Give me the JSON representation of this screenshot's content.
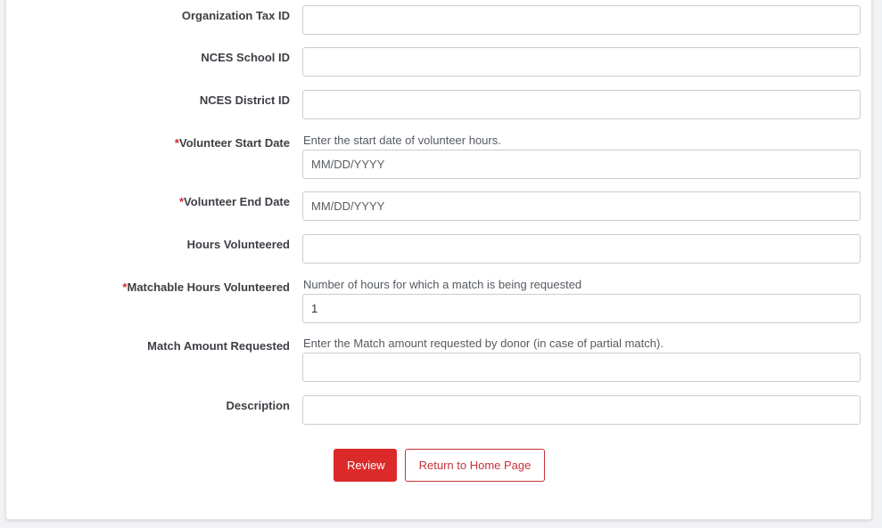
{
  "form": {
    "fields": [
      {
        "label": "Organization Tax ID",
        "required": false,
        "help": "",
        "value": "",
        "placeholder": ""
      },
      {
        "label": "NCES School ID",
        "required": false,
        "help": "",
        "value": "",
        "placeholder": ""
      },
      {
        "label": "NCES District ID",
        "required": false,
        "help": "",
        "value": "",
        "placeholder": ""
      },
      {
        "label": "Volunteer Start Date",
        "required": true,
        "help": "Enter the start date of volunteer hours.",
        "value": "",
        "placeholder": "MM/DD/YYYY"
      },
      {
        "label": "Volunteer End Date",
        "required": true,
        "help": "",
        "value": "",
        "placeholder": "MM/DD/YYYY"
      },
      {
        "label": "Hours Volunteered",
        "required": false,
        "help": "",
        "value": "",
        "placeholder": ""
      },
      {
        "label": "Matchable Hours Volunteered",
        "required": true,
        "help": "Number of hours for which a match is being requested",
        "value": "1",
        "placeholder": ""
      },
      {
        "label": "Match Amount Requested",
        "required": false,
        "help": "Enter the Match amount requested by donor (in case of partial match).",
        "value": "",
        "placeholder": ""
      },
      {
        "label": "Description",
        "required": false,
        "help": "",
        "value": "",
        "placeholder": ""
      }
    ],
    "required_marker": "*"
  },
  "actions": {
    "review_label": "Review",
    "home_label": "Return to Home Page"
  },
  "colors": {
    "accent": "#dc2a2a",
    "required": "#d22b2b"
  }
}
